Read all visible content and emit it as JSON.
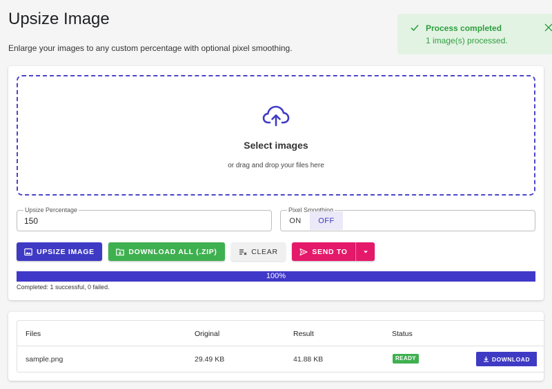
{
  "header": {
    "title": "Upsize Image",
    "subtitle": "Enlarge your images to any custom percentage with optional pixel smoothing."
  },
  "toast": {
    "title": "Process completed",
    "message": "1 image(s) processed.",
    "icon": "check-icon",
    "close_icon": "close-icon",
    "color": "#2e9e3f"
  },
  "dropzone": {
    "icon": "cloud-upload-icon",
    "title": "Select images",
    "subtitle": "or drag and drop your files here"
  },
  "options": {
    "percentage_label": "Upsize Percentage",
    "percentage_value": "150",
    "smoothing_label": "Pixel Smoothing",
    "smoothing_on": "ON",
    "smoothing_off": "OFF",
    "smoothing_selected": "OFF"
  },
  "actions": {
    "upsize_label": "UPSIZE IMAGE",
    "download_all_label": "DOWNLOAD ALL (.ZIP)",
    "clear_label": "CLEAR",
    "send_to_label": "SEND TO"
  },
  "progress": {
    "value": 100,
    "label": "100%",
    "status": "Completed: 1 successful, 0 failed."
  },
  "table": {
    "headers": [
      "Files",
      "Original",
      "Result",
      "Status"
    ],
    "rows": [
      {
        "file": "sample.png",
        "original": "29.49 KB",
        "result": "41.88 KB",
        "status": "READY",
        "action": "DOWNLOAD"
      }
    ]
  },
  "colors": {
    "primary": "#3f3ac4",
    "success": "#3fb050",
    "accent": "#e5196a"
  }
}
